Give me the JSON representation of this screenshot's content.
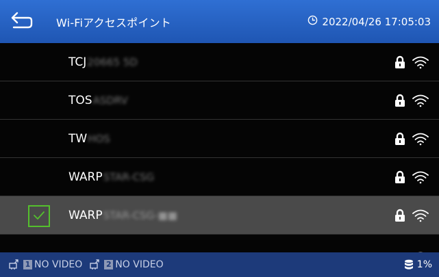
{
  "header": {
    "title": "Wi-Fiアクセスポイント",
    "datetime": "2022/04/26 17:05:03"
  },
  "networks": [
    {
      "ssid_prefix": "TCJ",
      "ssid_redacted": "20665 5D",
      "selected": false
    },
    {
      "ssid_prefix": "TOS",
      "ssid_redacted": "ASDRV",
      "selected": false
    },
    {
      "ssid_prefix": "TW",
      "ssid_redacted": "HOS",
      "selected": false
    },
    {
      "ssid_prefix": "WARP",
      "ssid_redacted": "STAR-CSG",
      "selected": false
    },
    {
      "ssid_prefix": "WARP",
      "ssid_redacted": "STAR-CSG-■■",
      "selected": true
    }
  ],
  "footer": {
    "video1_num": "1",
    "video1_label": "NO VIDEO",
    "video2_num": "2",
    "video2_label": "NO VIDEO",
    "storage": "1%"
  },
  "colors": {
    "header": "#2460c4",
    "footer": "#1d3a7a",
    "selected_row": "#4a4a4a",
    "check": "#54c02d"
  },
  "icons": [
    "back-arrow-icon",
    "clock-icon",
    "lock-icon",
    "wifi-icon",
    "checkmark-icon",
    "camera-icon",
    "storage-icon"
  ]
}
